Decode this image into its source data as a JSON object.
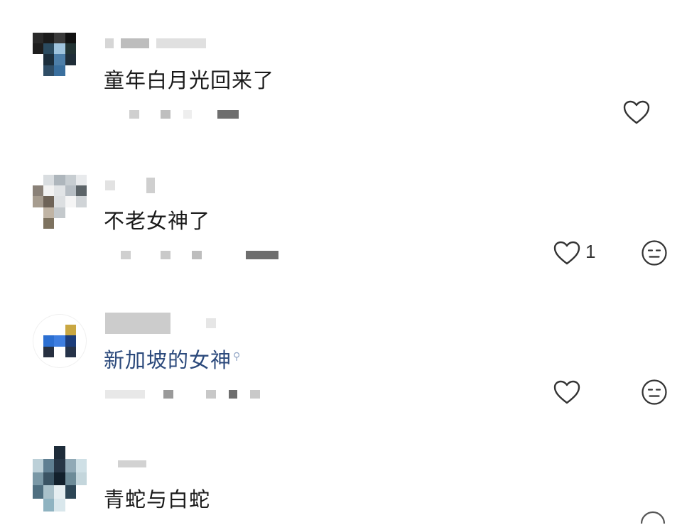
{
  "comments": [
    {
      "text": "童年白月光回来了",
      "is_link": false,
      "likes": "",
      "show_emoji": false
    },
    {
      "text": "不老女神了",
      "is_link": false,
      "likes": "1",
      "show_emoji": true
    },
    {
      "text": "新加坡的女神",
      "is_link": true,
      "likes": "",
      "show_emoji": true
    },
    {
      "text": "青蛇与白蛇",
      "is_link": false,
      "likes": "",
      "show_emoji": false
    }
  ],
  "icons": {
    "like": "heart-outline-icon",
    "reaction": "neutral-face-icon",
    "search": "search-icon"
  },
  "colors": {
    "text": "#1a1a1a",
    "link_text": "#2c4a7c",
    "icon": "#333333"
  }
}
